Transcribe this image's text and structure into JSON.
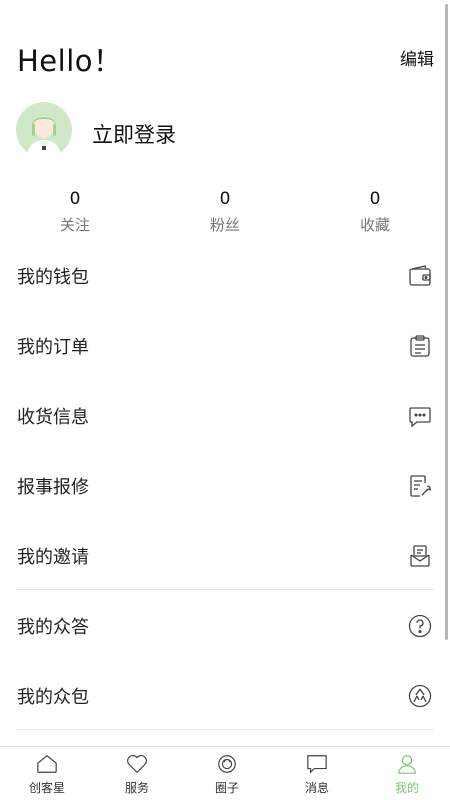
{
  "header": {
    "greeting": "Hello！",
    "edit_label": "编辑"
  },
  "profile": {
    "login_label": "立即登录",
    "avatar_icon": "user-avatar-icon"
  },
  "stats": [
    {
      "value": "0",
      "label": "关注"
    },
    {
      "value": "0",
      "label": "粉丝"
    },
    {
      "value": "0",
      "label": "收藏"
    }
  ],
  "menu": [
    {
      "label": "我的钱包",
      "icon": "wallet-icon"
    },
    {
      "label": "我的订单",
      "icon": "clipboard-icon"
    },
    {
      "label": "收货信息",
      "icon": "chat-bubble-icon"
    },
    {
      "label": "报事报修",
      "icon": "edit-wrench-icon"
    },
    {
      "label": "我的邀请",
      "icon": "envelope-icon"
    },
    {
      "label": "我的众答",
      "icon": "question-circle-icon"
    },
    {
      "label": "我的众包",
      "icon": "crowd-package-icon"
    }
  ],
  "tabbar": [
    {
      "label": "创客星",
      "icon": "home-icon",
      "active": false
    },
    {
      "label": "服务",
      "icon": "heart-icon",
      "active": false
    },
    {
      "label": "圈子",
      "icon": "circle-icon",
      "active": false
    },
    {
      "label": "消息",
      "icon": "message-icon",
      "active": false
    },
    {
      "label": "我的",
      "icon": "person-icon",
      "active": true
    }
  ],
  "colors": {
    "accent": "#7cc576",
    "text": "#1a1a1a",
    "muted": "#777777",
    "divider": "#e6e6e6"
  }
}
